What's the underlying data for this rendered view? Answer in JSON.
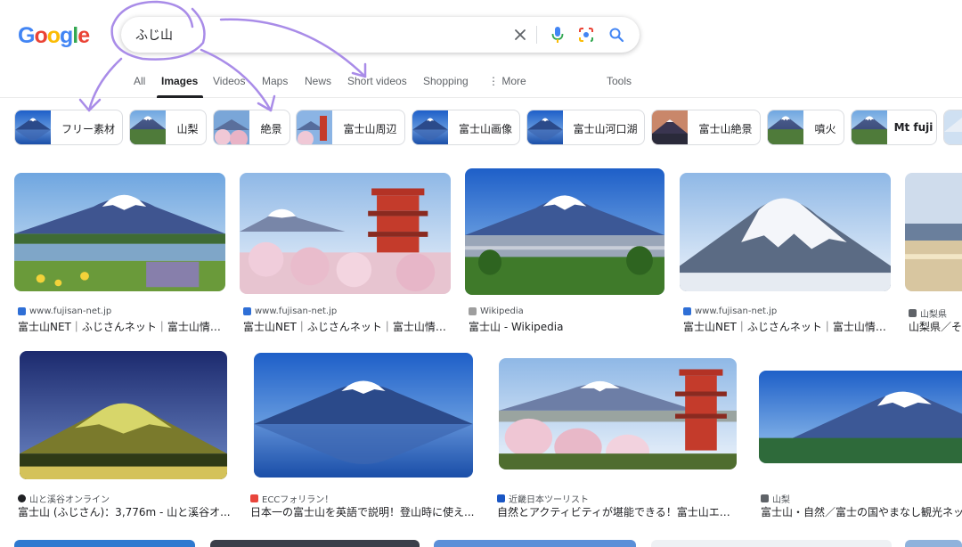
{
  "logo": {
    "letters": [
      "G",
      "o",
      "o",
      "g",
      "l",
      "e"
    ],
    "colors": [
      "#4285f4",
      "#ea4335",
      "#fbbc05",
      "#4285f4",
      "#34a853",
      "#ea4335"
    ]
  },
  "search": {
    "value": "ふじ山",
    "clear_icon": "close-icon",
    "voice_icon": "mic-icon",
    "lens_icon": "camera-lens-icon",
    "search_icon": "magnifier-icon"
  },
  "tabs": [
    {
      "label": "All",
      "active": false
    },
    {
      "label": "Images",
      "active": true
    },
    {
      "label": "Videos",
      "active": false
    },
    {
      "label": "Maps",
      "active": false
    },
    {
      "label": "News",
      "active": false
    },
    {
      "label": "Short videos",
      "active": false
    },
    {
      "label": "Shopping",
      "active": false
    },
    {
      "label": "⋮ More",
      "active": false
    },
    {
      "label": "Tools",
      "active": false
    }
  ],
  "chips": [
    {
      "label": "フリー素材"
    },
    {
      "label": "山梨"
    },
    {
      "label": "絶景"
    },
    {
      "label": "富士山周辺"
    },
    {
      "label": "富士山画像"
    },
    {
      "label": "富士山河口湖"
    },
    {
      "label": "富士山絶景"
    },
    {
      "label": "噴火"
    },
    {
      "label": "Mt fuji"
    }
  ],
  "results_row1": [
    {
      "source": "www.fujisan-net.jp",
      "title": "富士山NET｜ふじさんネット｜富士山情報..."
    },
    {
      "source": "www.fujisan-net.jp",
      "title": "富士山NET｜ふじさんネット｜富士山情報..."
    },
    {
      "source": "Wikipedia",
      "title": "富士山 - Wikipedia"
    },
    {
      "source": "www.fujisan-net.jp",
      "title": "富士山NET｜ふじさんネット｜富士山情報..."
    },
    {
      "source": "山梨県",
      "title": "山梨県／そ"
    }
  ],
  "results_row2": [
    {
      "source": "山と溪谷オンライン",
      "title": "富士山 (ふじさん)：3,776m - 山と溪谷オ..."
    },
    {
      "source": "ECCフォリラン！",
      "title": "日本一の富士山を英語で説明！登山時に使え..."
    },
    {
      "source": "近畿日本ツーリスト",
      "title": "自然とアクティビティが堪能できる！富士山エリ..."
    },
    {
      "source": "山梨",
      "title": "富士山・自然／富士の国やまなし観光ネッ"
    }
  ],
  "colors": {
    "annotation": "#a98ce8",
    "accent": "#1a73e8"
  }
}
